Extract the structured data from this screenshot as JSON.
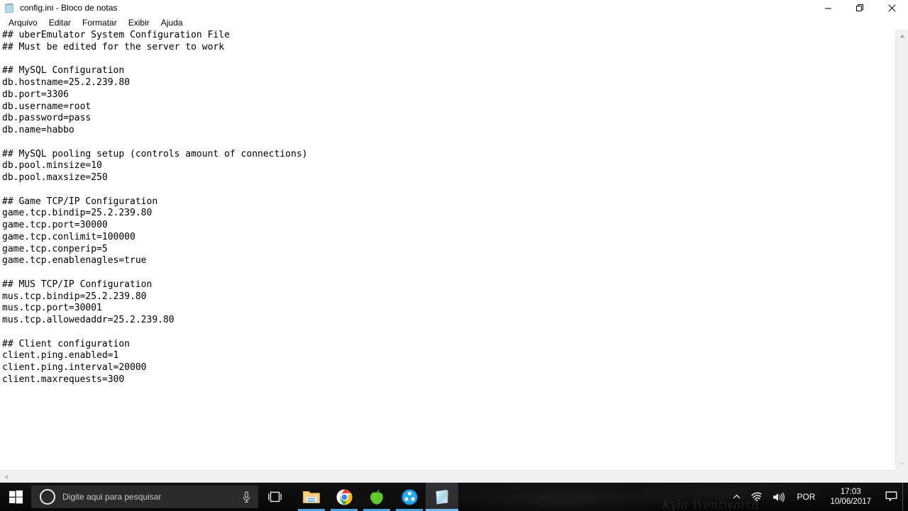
{
  "window": {
    "icon": "notepad-icon",
    "title": "config.ini - Bloco de notas",
    "controls": {
      "minimize": "minimize-icon",
      "restore": "restore-icon",
      "close": "close-icon"
    }
  },
  "menubar": {
    "items": [
      {
        "label": "Arquivo"
      },
      {
        "label": "Editar"
      },
      {
        "label": "Formatar"
      },
      {
        "label": "Exibir"
      },
      {
        "label": "Ajuda"
      }
    ]
  },
  "editor": {
    "content": "## uberEmulator System Configuration File\n## Must be edited for the server to work\n\n## MySQL Configuration\ndb.hostname=25.2.239.80\ndb.port=3306\ndb.username=root\ndb.password=pass\ndb.name=habbo\n\n## MySQL pooling setup (controls amount of connections)\ndb.pool.minsize=10\ndb.pool.maxsize=250\n\n## Game TCP/IP Configuration\ngame.tcp.bindip=25.2.239.80\ngame.tcp.port=30000\ngame.tcp.conlimit=100000\ngame.tcp.conperip=5\ngame.tcp.enablenagles=true\n\n## MUS TCP/IP Configuration\nmus.tcp.bindip=25.2.239.80\nmus.tcp.port=30001\nmus.tcp.allowedaddr=25.2.239.80\n\n## Client configuration\nclient.ping.enabled=1\nclient.ping.interval=20000\nclient.maxrequests=300",
    "lines": [
      "## uberEmulator System Configuration File",
      "## Must be edited for the server to work",
      "",
      "## MySQL Configuration",
      "db.hostname=25.2.239.80",
      "db.port=3306",
      "db.username=root",
      "db.password=pass",
      "db.name=habbo",
      "",
      "## MySQL pooling setup (controls amount of connections)",
      "db.pool.minsize=10",
      "db.pool.maxsize=250",
      "",
      "## Game TCP/IP Configuration",
      "game.tcp.bindip=25.2.239.80",
      "game.tcp.port=30000",
      "game.tcp.conlimit=100000",
      "game.tcp.conperip=5",
      "game.tcp.enablenagles=true",
      "",
      "## MUS TCP/IP Configuration",
      "mus.tcp.bindip=25.2.239.80",
      "mus.tcp.port=30001",
      "mus.tcp.allowedaddr=25.2.239.80",
      "",
      "## Client configuration",
      "client.ping.enabled=1",
      "client.ping.interval=20000",
      "client.maxrequests=300"
    ],
    "scrollbars": {
      "vertical_up": "scroll-up-arrow",
      "vertical_down": "scroll-down-arrow",
      "horizontal_left": "scroll-left-arrow",
      "horizontal_right": "scroll-right-arrow"
    }
  },
  "taskbar": {
    "start": "windows-logo-icon",
    "search": {
      "placeholder": "Digite aqui para pesquisar",
      "cortana_icon": "cortana-ring-icon",
      "mic_icon": "microphone-icon"
    },
    "task_view": "task-view-icon",
    "apps": [
      {
        "name": "file-explorer",
        "icon": "folder-icon",
        "active": false
      },
      {
        "name": "google-chrome",
        "icon": "chrome-icon",
        "active": false
      },
      {
        "name": "green-apple-app",
        "icon": "apple-icon",
        "active": false
      },
      {
        "name": "blue-circle-app",
        "icon": "circles-icon",
        "active": false
      },
      {
        "name": "notepad",
        "icon": "notepad-icon",
        "active": true
      }
    ],
    "tray": {
      "overflow_icon": "chevron-up-icon",
      "network_icon": "wifi-icon",
      "volume_icon": "speaker-icon",
      "language": "POR",
      "time": "17:03",
      "date": "10/06/2017",
      "action_center_icon": "notification-bubble-icon"
    },
    "watermark": "Kyla Wentworth"
  }
}
